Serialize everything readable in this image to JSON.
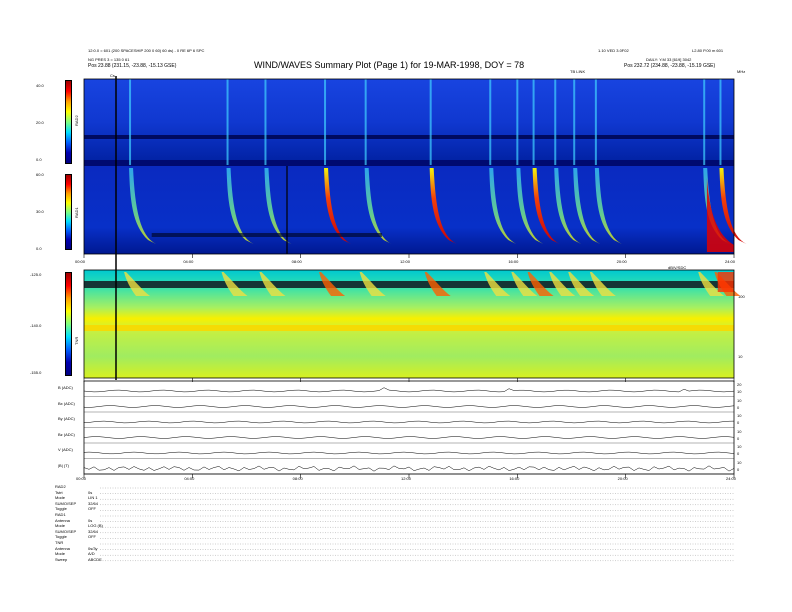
{
  "header": {
    "left_line1": "12:0.0 = 601 (200 SPACESHIP 200 0 60) 60 ds) - 0 RE 6P 6 SPC",
    "left_line2": "NG PRES 3 = 135 0 61",
    "left_pos": "Pos   23.88 (231.15, -23.88, -15.13 GSE)",
    "center_top": "1.10 VED 3.0F02",
    "title": "WIND/WAVES Summary Plot (Page 1) for 19-MAR-1998, DOY = 78",
    "right_top": "L2.80 P.00 m 601",
    "right_line2": "DAILY: Y.M 33 [619] 3042",
    "right_pos": "Pos   232.72 (234.88, -23.88, -15.19 GSE)",
    "tb_label": "TB LINK",
    "cs_label": "Cs",
    "mhz_label": "MHz"
  },
  "panels": {
    "rad2": {
      "ylabel": "RAD2",
      "ticks": [
        "40.0",
        "20.0",
        "0.0"
      ]
    },
    "rad1": {
      "ylabel": "RAD1",
      "ticks": [
        "60.0",
        "30.0",
        "0.0"
      ]
    },
    "tnr": {
      "ylabel": "TNR",
      "ticks": [
        "-125.0",
        "-140.0",
        "-155.0"
      ],
      "right_ticks": [
        "100",
        "10"
      ],
      "corner_label": "dB/V/SDC"
    },
    "time_ticks": [
      "00:00",
      "04:00",
      "08:00",
      "12:00",
      "16:00",
      "20:00",
      "24:00"
    ]
  },
  "mag": {
    "rows": [
      {
        "label": "B (ADC)",
        "r": [
          "20",
          "10"
        ]
      },
      {
        "label": "Bx (ADC)",
        "r": [
          "10",
          "0"
        ]
      },
      {
        "label": "By (ADC)",
        "r": [
          "10",
          "0"
        ]
      },
      {
        "label": "Bz (ADC)",
        "r": [
          "10",
          "0"
        ]
      },
      {
        "label": "V (ADC)",
        "r": [
          "10",
          "0"
        ]
      },
      {
        "label": "|B| (T)",
        "r": [
          "10",
          "0"
        ]
      }
    ],
    "time_ticks": [
      "00:00",
      "04:00",
      "08:00",
      "12:00",
      "16:00",
      "20:00",
      "24:00"
    ]
  },
  "params": [
    {
      "k": "RAD2",
      "v": ""
    },
    {
      "k": "Tstrt",
      "v": "0s"
    },
    {
      "k": "Mode",
      "v": "LIN 1"
    },
    {
      "k": "SUMO/SEP",
      "v": "32/64"
    },
    {
      "k": "Toggle",
      "v": "OFF"
    },
    {
      "k": "RAD1",
      "v": ""
    },
    {
      "k": "Antenna",
      "v": "0s"
    },
    {
      "k": "Mode",
      "v": "LOG (B)"
    },
    {
      "k": "SUMO/SEP",
      "v": "32/64"
    },
    {
      "k": "Toggle",
      "v": "OFF"
    },
    {
      "k": "TNR",
      "v": ""
    },
    {
      "k": "Antenna",
      "v": "0s/3y"
    },
    {
      "k": "Mode",
      "v": "A/D"
    },
    {
      "k": "Sweep",
      "v": "ABCDE"
    }
  ],
  "chart_data": {
    "type": "heatmap",
    "title": "WIND/WAVES Summary Plot (Page 1) for 19-MAR-1998, DOY = 78",
    "x_range_hours": [
      0,
      24
    ],
    "x_ticks": [
      "00:00",
      "04:00",
      "08:00",
      "12:00",
      "16:00",
      "20:00",
      "24:00"
    ],
    "colormap": "jet",
    "panels": [
      {
        "name": "RAD2",
        "y_ticks": [
          40.0,
          20.0,
          0.0
        ]
      },
      {
        "name": "RAD1",
        "y_ticks": [
          60.0,
          30.0,
          0.0
        ]
      },
      {
        "name": "TNR",
        "y_ticks": [
          -125.0,
          -140.0,
          -155.0
        ],
        "right_axis_ticks": [
          100,
          10
        ]
      }
    ],
    "type_iii_bursts_hours": [
      1.7,
      5.3,
      6.7,
      8.9,
      10.4,
      12.8,
      15.0,
      16.0,
      16.6,
      17.4,
      18.1,
      18.9,
      22.9,
      23.5
    ]
  }
}
